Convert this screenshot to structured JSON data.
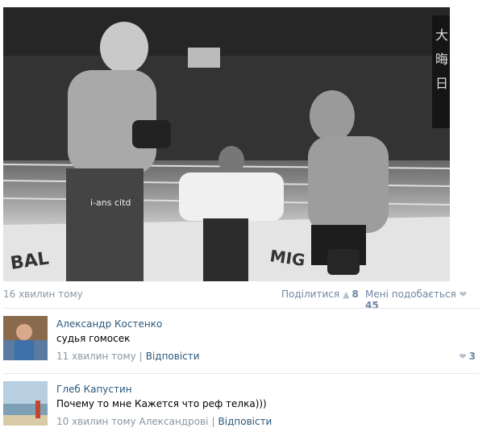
{
  "post": {
    "photo": {
      "shorts_text": "i-ans citd",
      "mat_text_left": "BAL",
      "mat_text_right": "MIG"
    },
    "time": "16 хвилин тому",
    "share_label": "Поділитися",
    "share_count": "8",
    "like_label": "Мені подобається",
    "like_count": "45"
  },
  "comments": [
    {
      "author": "Александр Костенко",
      "text": "судья гомосек",
      "time": "11 хвилин тому",
      "reply": "Відповісти",
      "likes": "3"
    },
    {
      "author": "Глеб Капустин",
      "text": "Почему то мне Кажется что реф телка)))",
      "time": "10 хвилин тому Александрові",
      "reply": "Відповісти"
    }
  ],
  "icons": {
    "share": "megaphone-icon",
    "like": "heart-icon"
  }
}
